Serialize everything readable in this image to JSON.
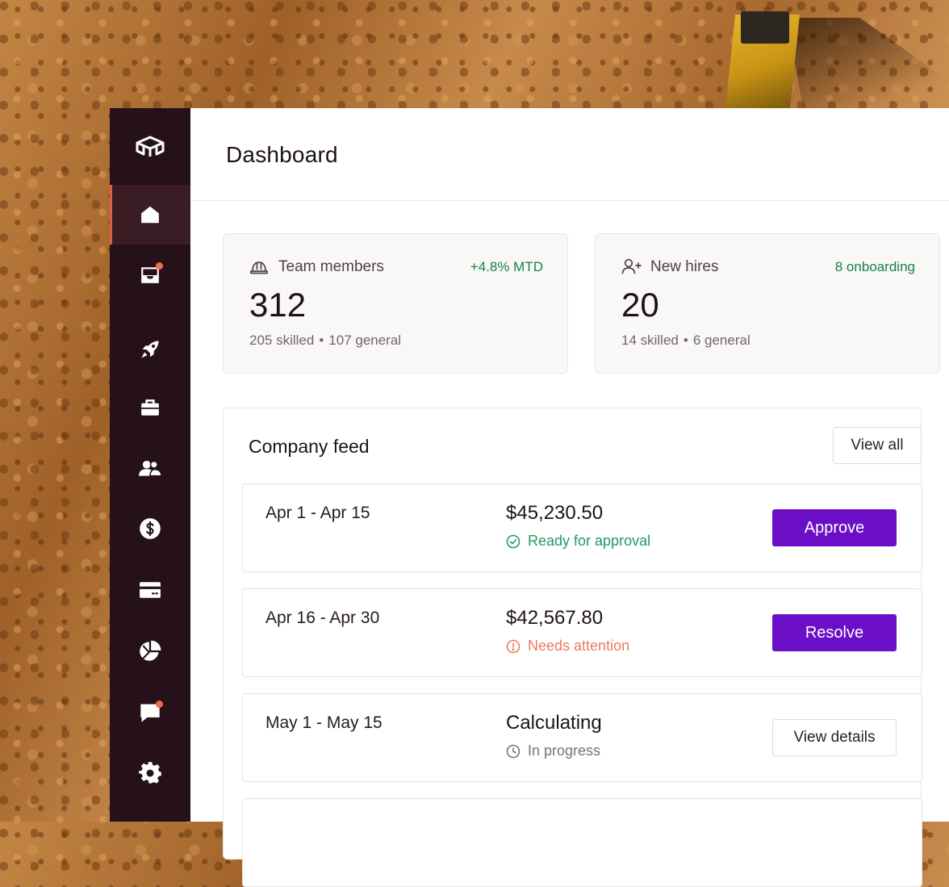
{
  "page": {
    "title": "Dashboard"
  },
  "colors": {
    "sidebar": "#26111a",
    "accent": "#6a0fc7",
    "success": "#1f9a63",
    "warning": "#ea7a5f",
    "nav_indicator": "#e25c4b"
  },
  "sidebar": {
    "logo_icon": "cube-logo-icon",
    "items": [
      {
        "icon": "home-icon",
        "active": true,
        "badge": false
      },
      {
        "icon": "inbox-icon",
        "active": false,
        "badge": true
      },
      {
        "icon": "rocket-icon",
        "active": false,
        "badge": false
      },
      {
        "icon": "briefcase-icon",
        "active": false,
        "badge": false
      },
      {
        "icon": "users-icon",
        "active": false,
        "badge": false
      },
      {
        "icon": "dollar-icon",
        "active": false,
        "badge": false
      },
      {
        "icon": "credit-card-icon",
        "active": false,
        "badge": false
      },
      {
        "icon": "pie-chart-icon",
        "active": false,
        "badge": false
      },
      {
        "icon": "chat-icon",
        "active": false,
        "badge": true
      },
      {
        "icon": "gear-icon",
        "active": false,
        "badge": false
      }
    ]
  },
  "stats": [
    {
      "icon": "hard-hat-icon",
      "label": "Team members",
      "delta": "+4.8% MTD",
      "value": "312",
      "sub_a": "205 skilled",
      "sub_sep": "•",
      "sub_b": "107 general"
    },
    {
      "icon": "user-plus-icon",
      "label": "New hires",
      "delta": "8 onboarding",
      "value": "20",
      "sub_a": "14 skilled",
      "sub_sep": "•",
      "sub_b": "6 general"
    }
  ],
  "feed": {
    "title": "Company feed",
    "view_all_label": "View all",
    "rows": [
      {
        "date": "Apr 1 - Apr 15",
        "amount": "$45,230.50",
        "status": "Ready for approval",
        "status_icon": "check-circle-icon",
        "action": "Approve"
      },
      {
        "date": "Apr 16 - Apr 30",
        "amount": "$42,567.80",
        "status": "Needs attention",
        "status_icon": "alert-circle-icon",
        "action": "Resolve"
      },
      {
        "date": "May 1 - May 15",
        "amount": "Calculating",
        "status": "In progress",
        "status_icon": "clock-icon",
        "action": "View details"
      }
    ]
  }
}
